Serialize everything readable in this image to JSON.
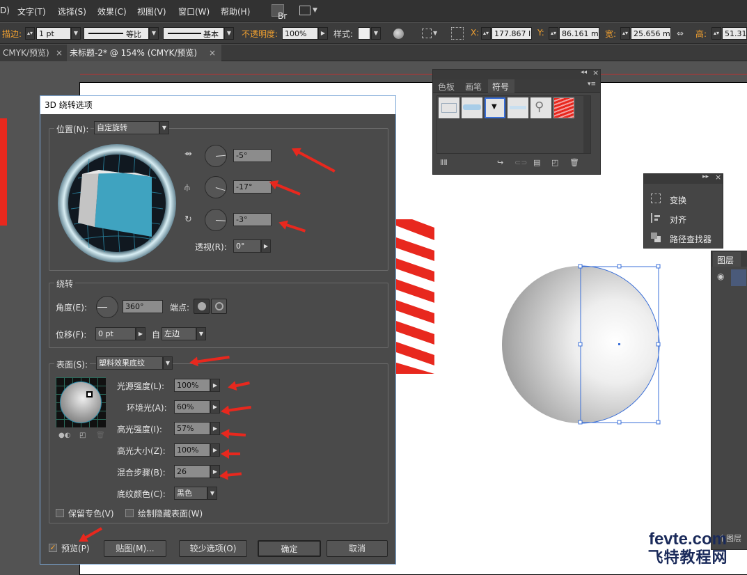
{
  "menu": {
    "items": [
      "D)",
      "文字(T)",
      "选择(S)",
      "效果(C)",
      "视图(V)",
      "窗口(W)",
      "帮助(H)"
    ],
    "br": "Br"
  },
  "control": {
    "stroke_label": "描边:",
    "stroke_value": "1 pt",
    "profile_label": "等比",
    "brush_label": "基本",
    "opacity_label": "不透明度:",
    "opacity_value": "100%",
    "style_label": "样式:",
    "x_label": "X:",
    "x_value": "177.867 I",
    "y_label": "Y:",
    "y_value": "86.161 m",
    "w_label": "宽:",
    "w_value": "25.656 m",
    "h_label": "高:",
    "h_value": "51.31"
  },
  "tabs": [
    {
      "label": "CMYK/预览)"
    },
    {
      "label": "未标题-2* @ 154% (CMYK/预览)"
    }
  ],
  "swatch_panel": {
    "tabs": [
      "色板",
      "画笔",
      "符号"
    ]
  },
  "mini_panel": {
    "items": [
      "变换",
      "对齐",
      "路径查找器"
    ]
  },
  "layers_panel": {
    "title": "图层",
    "footer": "个图层"
  },
  "dialog": {
    "title": "3D 绕转选项",
    "position_label": "位置(N):",
    "position_value": "自定旋转",
    "rot_x": "-5°",
    "rot_y": "-17°",
    "rot_z": "-3°",
    "perspective_label": "透视(R):",
    "perspective_value": "0°",
    "revolve_title": "绕转",
    "angle_label": "角度(E):",
    "angle_value": "360°",
    "cap_label": "端点:",
    "offset_label": "位移(F):",
    "offset_value": "0 pt",
    "from_label": "自",
    "from_value": "左边",
    "surface_label": "表面(S):",
    "surface_value": "塑料效果底纹",
    "light_intensity_label": "光源强度(L):",
    "light_intensity_value": "100%",
    "ambient_label": "环境光(A):",
    "ambient_value": "60%",
    "highlight_intensity_label": "高光强度(I):",
    "highlight_intensity_value": "57%",
    "highlight_size_label": "高光大小(Z):",
    "highlight_size_value": "100%",
    "blend_steps_label": "混合步骤(B):",
    "blend_steps_value": "26",
    "shade_color_label": "底纹颜色(C):",
    "shade_color_value": "黑色",
    "preserve_spot_label": "保留专色(V)",
    "draw_hidden_label": "绘制隐藏表面(W)",
    "preview_label": "预览(P)",
    "map_art_button": "贴图(M)...",
    "fewer_options_button": "较少选项(O)",
    "ok_button": "确定",
    "cancel_button": "取消"
  },
  "watermark": {
    "line1": "fevte.com",
    "line2": "飞特教程网"
  },
  "colors": {
    "accent_red": "#e8281e",
    "dialog_bg": "#4a4a4a",
    "cube_face": "#3fa3c0",
    "selection_blue": "#3a6fd8"
  }
}
